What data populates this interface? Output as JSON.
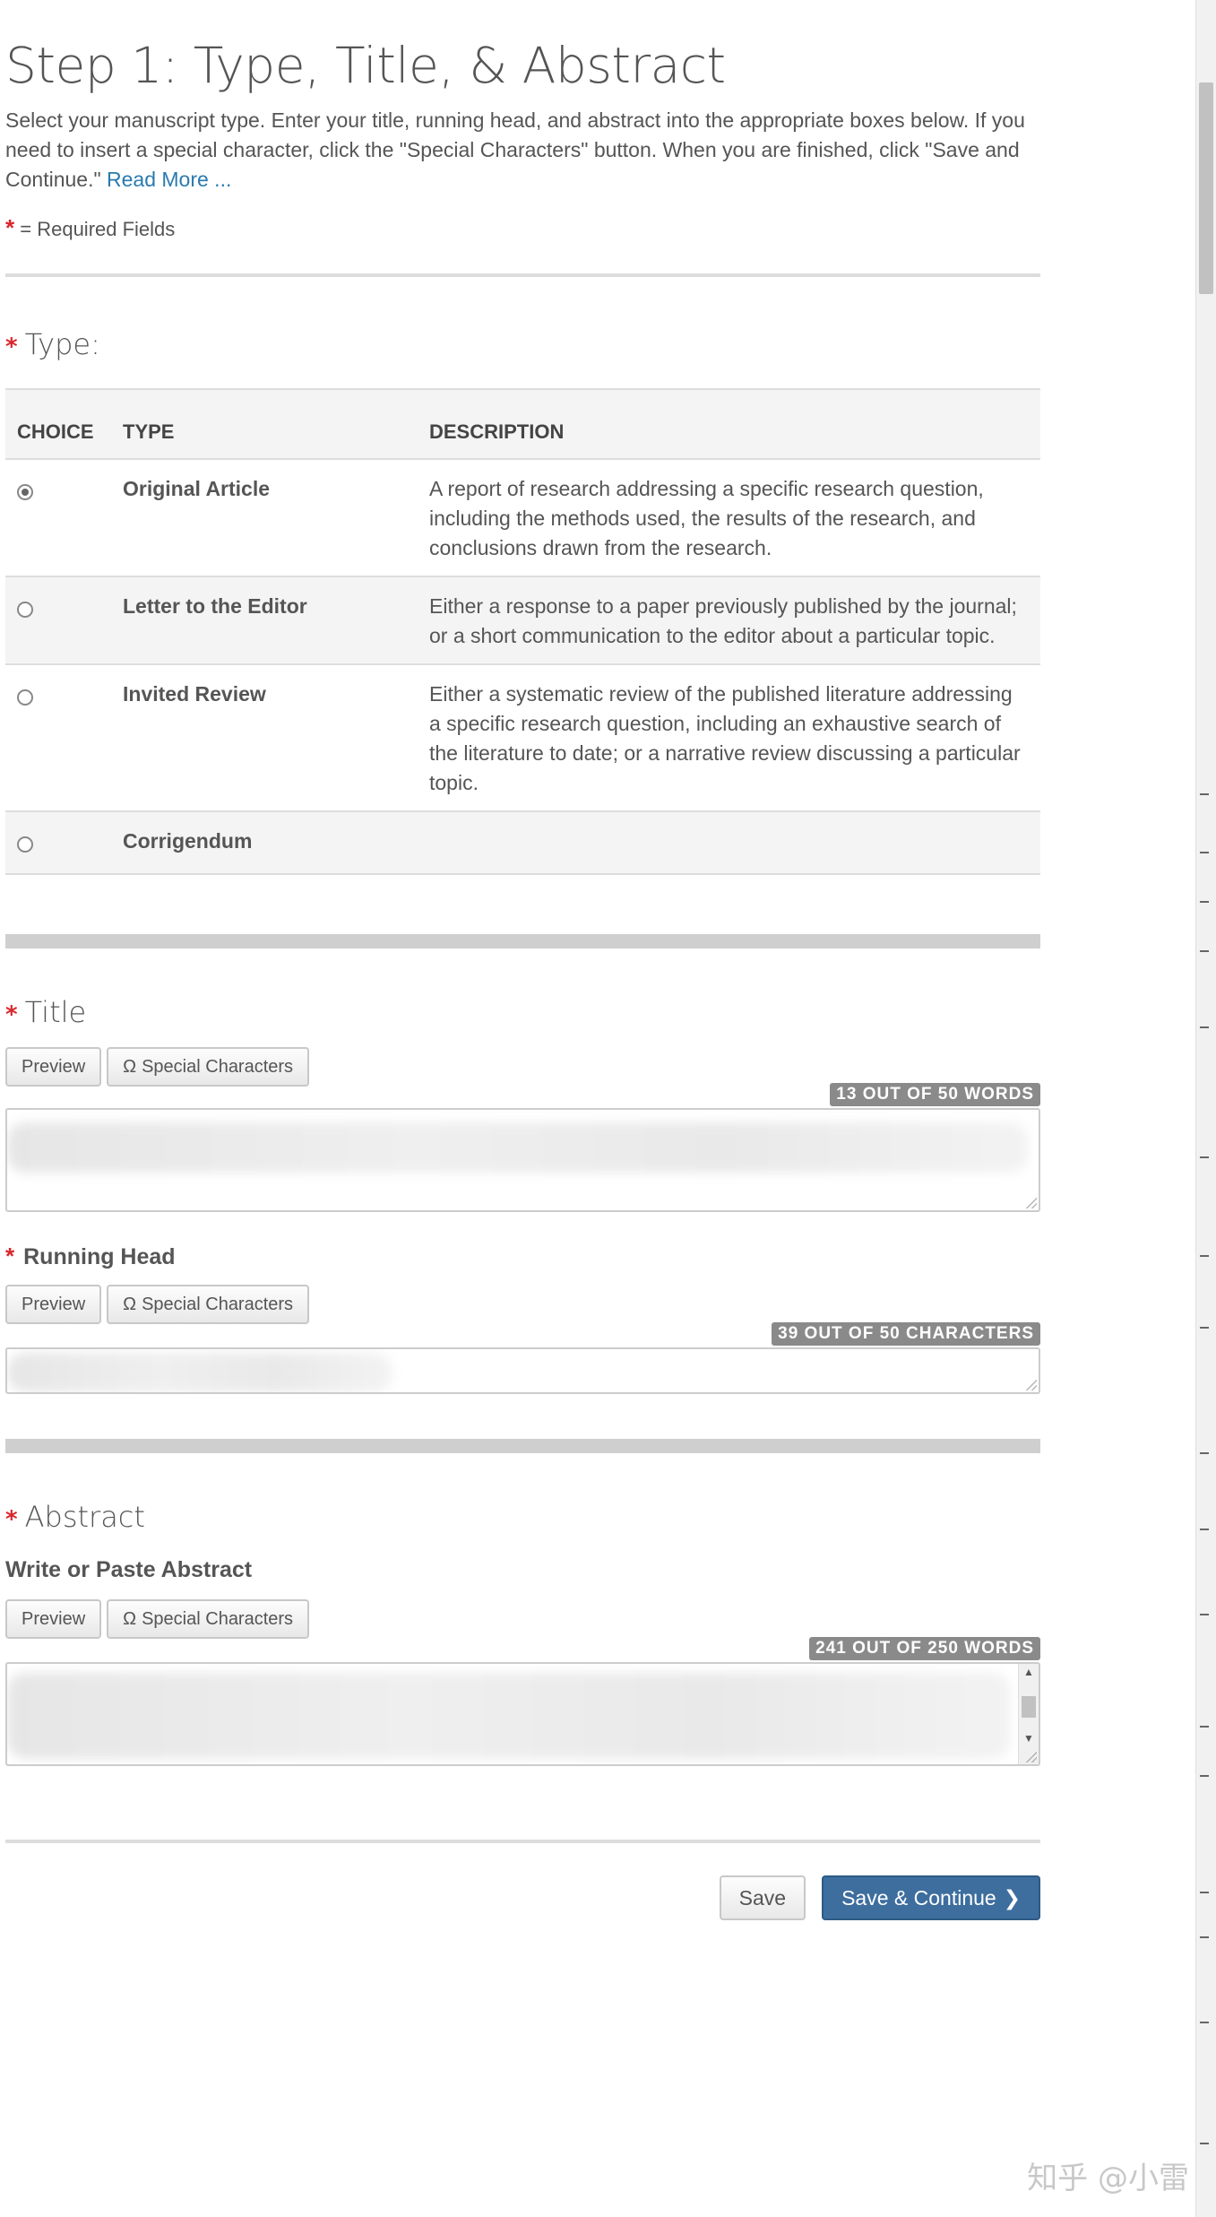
{
  "header": {
    "title": "Step 1: Type, Title, & Abstract",
    "intro": "Select your manuscript type. Enter your title, running head, and abstract into the appropriate boxes below. If you need to insert a special character, click the \"Special Characters\" button. When you are finished, click \"Save and Continue.\"",
    "read_more": "Read More ...",
    "required_star": "*",
    "required_legend": "= Required Fields"
  },
  "type_section": {
    "label": "Type:",
    "columns": [
      "CHOICE",
      "TYPE",
      "DESCRIPTION"
    ],
    "rows": [
      {
        "name": "Original Article",
        "description": "A report of research addressing a specific research question, including the methods used, the results of the research, and conclusions drawn from the research.",
        "selected": true
      },
      {
        "name": "Letter to the Editor",
        "description": "Either a response to a paper previously published by the journal; or a short communication to the editor about a particular topic.",
        "selected": false
      },
      {
        "name": "Invited Review",
        "description": "Either a systematic review of the published literature addressing a specific research question, including an exhaustive search of the literature to date; or a narrative review discussing a particular topic.",
        "selected": false
      },
      {
        "name": "Corrigendum",
        "description": "",
        "selected": false
      }
    ]
  },
  "title_section": {
    "label": "Title",
    "preview": "Preview",
    "special_chars": "Special Characters",
    "omega_icon": "Ω",
    "counter": "13 OUT OF 50 WORDS"
  },
  "running_head": {
    "label": "Running Head",
    "preview": "Preview",
    "special_chars": "Special Characters",
    "omega_icon": "Ω",
    "counter": "39 OUT OF 50 CHARACTERS"
  },
  "abstract_section": {
    "label": "Abstract",
    "sublabel": "Write or Paste Abstract",
    "preview": "Preview",
    "special_chars": "Special Characters",
    "omega_icon": "Ω",
    "counter": "241 OUT OF 250 WORDS"
  },
  "footer": {
    "save": "Save",
    "save_continue": "Save & Continue",
    "chevron_icon": "❯"
  },
  "watermark": "知乎 @小雷"
}
